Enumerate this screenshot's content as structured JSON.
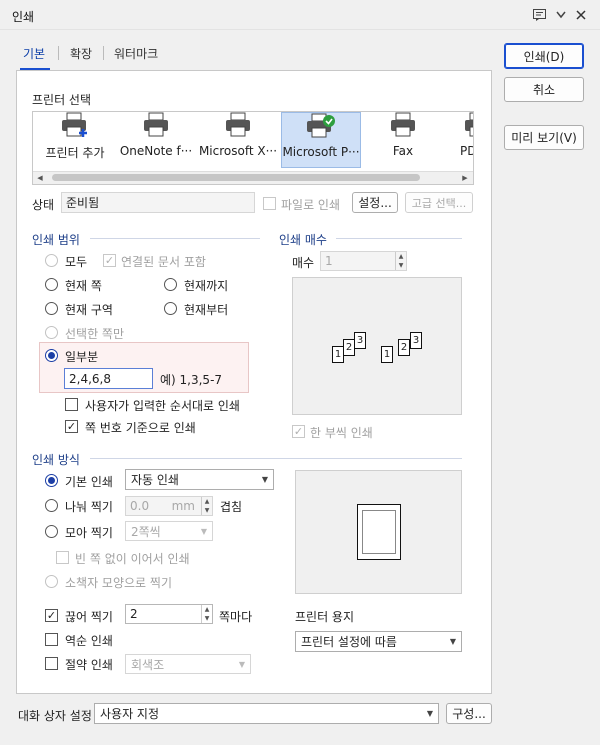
{
  "window": {
    "title": "인쇄"
  },
  "tabs": [
    "기본",
    "확장",
    "워터마크"
  ],
  "right_buttons": {
    "print": "인쇄(D)",
    "cancel": "취소",
    "preview": "미리 보기(V)"
  },
  "printer_select": {
    "label": "프린터 선택",
    "printers": [
      "프린터 추가",
      "OneNote f···",
      "Microsoft X···",
      "Microsoft P···",
      "Fax",
      "PD"
    ],
    "selected_index": 3
  },
  "status": {
    "label": "상태",
    "value": "준비됨",
    "print_to_file": "파일로 인쇄",
    "settings": "설정...",
    "advanced": "고급 선택..."
  },
  "range": {
    "title": "인쇄 범위",
    "all": "모두",
    "include_linked": "연결된 문서 포함",
    "current_page": "현재 쪽",
    "to_current": "현재까지",
    "current_section": "현재 구역",
    "from_current": "현재부터",
    "selected_pages": "선택한 쪽만",
    "partial": "일부분",
    "partial_value": "2,4,6,8",
    "example": "예) 1,3,5-7",
    "user_order": "사용자가 입력한 순서대로 인쇄",
    "page_number_based": "쪽 번호 기준으로 인쇄"
  },
  "copies": {
    "title": "인쇄 매수",
    "label": "매수",
    "value": "1",
    "collate": "한 부씩 인쇄"
  },
  "method": {
    "title": "인쇄 방식",
    "basic": "기본 인쇄",
    "basic_value": "자동 인쇄",
    "divide": "나눠 찍기",
    "divide_value": "0.0",
    "divide_unit": "mm",
    "overlap": "겹침",
    "gather": "모아 찍기",
    "gather_value": "2쪽씩",
    "no_blank": "빈 쪽 없이 이어서 인쇄",
    "booklet": "소책자 모양으로 찍기",
    "split": "끊어 찍기",
    "split_value": "2",
    "split_unit": "쪽마다",
    "reverse": "역순 인쇄",
    "saving": "절약 인쇄",
    "saving_value": "회색조"
  },
  "paper": {
    "label": "프린터 용지",
    "value": "프린터 설정에 따름"
  },
  "dialog_settings": {
    "label": "대화 상자 설정",
    "value": "사용자 지정",
    "config": "구성..."
  },
  "colors": {
    "accent": "#1a4fd0",
    "group_title": "#1d3e88",
    "selected_printer": "#cfe0f7",
    "partial_highlight": "#fdf2f2"
  }
}
